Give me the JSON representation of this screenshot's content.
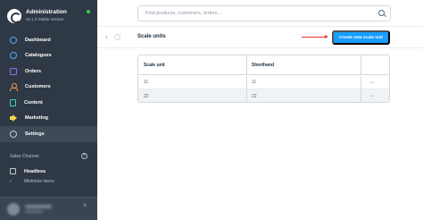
{
  "app": {
    "title": "Administration",
    "version": "v6.1.3 Stable Version"
  },
  "sidebar": {
    "items": [
      {
        "label": "Dashboard",
        "icon": "dashboard-icon"
      },
      {
        "label": "Catalogues",
        "icon": "catalogues-icon"
      },
      {
        "label": "Orders",
        "icon": "orders-icon"
      },
      {
        "label": "Customers",
        "icon": "customers-icon"
      },
      {
        "label": "Content",
        "icon": "content-icon"
      },
      {
        "label": "Marketing",
        "icon": "marketing-icon"
      },
      {
        "label": "Settings",
        "icon": "settings-icon",
        "active": true
      }
    ],
    "sales_channel_label": "Sales Channel",
    "sales_channel_items": [
      {
        "label": "Headless"
      }
    ],
    "minimize_label": "Minimize menu"
  },
  "search": {
    "placeholder": "Find products, customers, orders..."
  },
  "page": {
    "title": "Scale units",
    "create_button_label": "Create new scale unit"
  },
  "grid": {
    "columns": [
      "Scale unit",
      "Shorthand"
    ],
    "rows": [
      [
        "11",
        "11"
      ],
      [
        "22",
        "22"
      ]
    ],
    "row_action": "···"
  },
  "colors": {
    "sidebar_bg": "#2f3945",
    "accent": "#189eff",
    "annotation_arrow": "#e5353b",
    "status_online": "#37d046"
  }
}
